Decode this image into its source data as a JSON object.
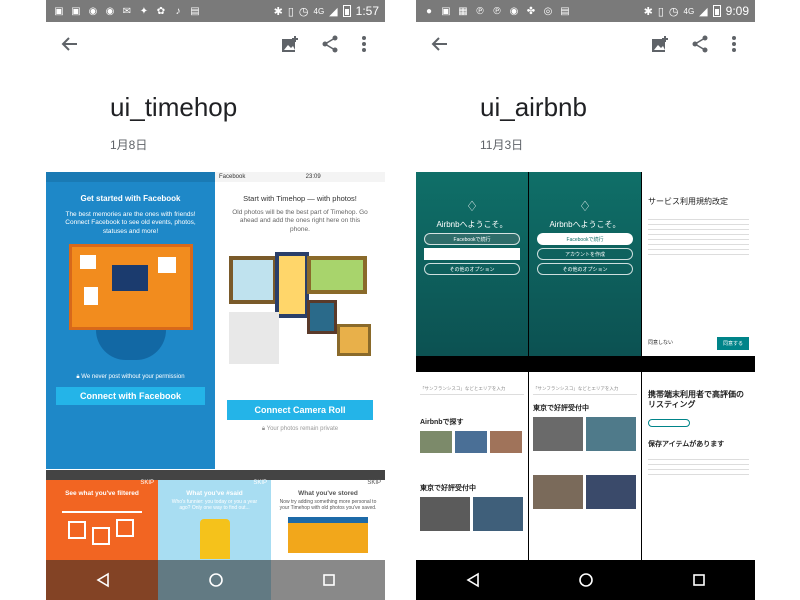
{
  "left": {
    "status_time": "1:57",
    "status_network": "4G",
    "album_title": "ui_timehop",
    "album_date": "1月8日",
    "thumbs": {
      "t1_title": "Get started with Facebook",
      "t1_body": "The best memories are the ones with friends! Connect Facebook to see old events, photos, statuses and more!",
      "t1_privacy": "We never post without your permission",
      "t1_button": "Connect with Facebook",
      "t2_time": "23:09",
      "t2_app": "Facebook",
      "t2_title": "Start with Timehop — with photos!",
      "t2_body": "Old photos will be the best part of Timehop. Go ahead and add the ones right here on this phone.",
      "t2_button": "Connect Camera Roll",
      "t2_note": "Your photos remain private",
      "t3_title": "See what you've filtered",
      "t4_title": "What you've #said",
      "t4_body": "Who's funnier: you today or you a year ago? Only one way to find out...",
      "t5_title": "What you've stored",
      "t5_body": "Now try adding something more personal to your Timehop with old photos you've saved.",
      "skip": "SKIP"
    }
  },
  "right": {
    "status_time": "9:09",
    "status_network": "4G",
    "album_title": "ui_airbnb",
    "album_date": "11月3日",
    "thumbs": {
      "welcome": "Airbnbへようこそ。",
      "fb_continue": "Facebookで続行",
      "create_account": "アカウントを作成",
      "other_options": "その他のオプション",
      "terms_title": "サービス利用規約改定",
      "agree": "同意する",
      "decline": "同意しない",
      "search_placeholder": "「サンフランシスコ」などとエリアを入力",
      "explore": "Airbnbで探す",
      "tokyo_experience": "東京で好評受付中",
      "mobile_title": "携帯端末利用者で高評価のリスティング",
      "saved_feature": "保存アイテムがあります"
    }
  },
  "colors": {
    "timehop_blue": "#1e88c8",
    "timehop_cyan": "#24b4e8",
    "airbnb_teal": "#0f6f68",
    "airbnb_red": "#ff5a5f"
  }
}
